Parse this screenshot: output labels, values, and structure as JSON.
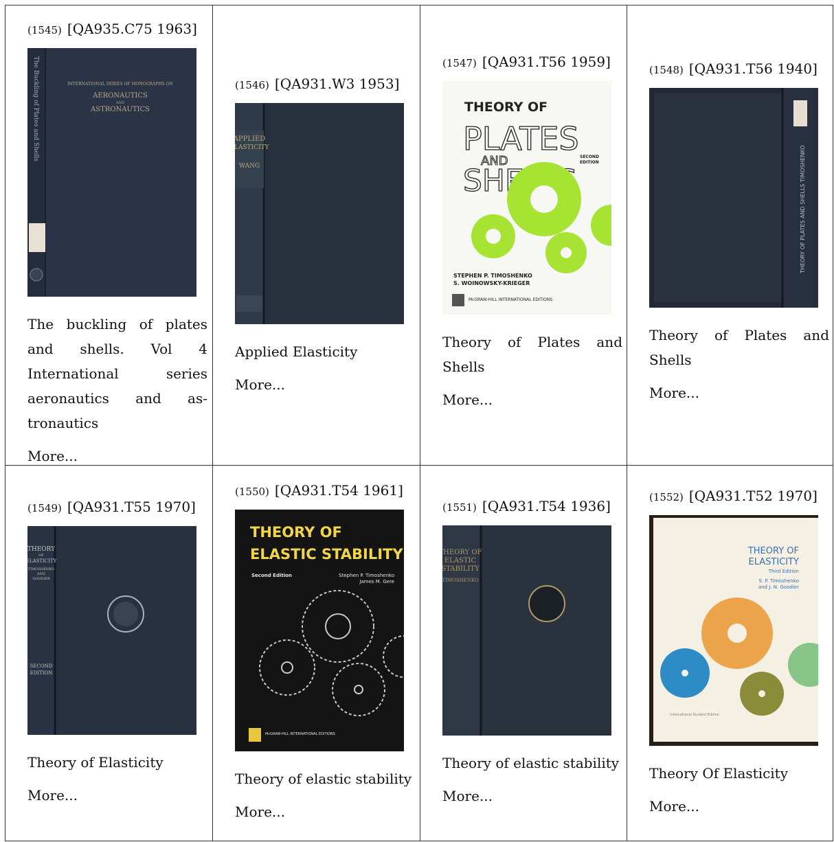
{
  "books": [
    {
      "num": "(1545)",
      "call": "[QA935.C75 1963]",
      "title": "The buckling of plates and shells. Vol 4 International series aeronautics and as-tronautics",
      "more": "More...",
      "cover": {
        "series": "INTERNATIONAL SERIES OF MONOGRAPHS ON",
        "line1": "AERONAUTICS",
        "and": "AND",
        "line2": "ASTRONAUTICS",
        "spine": "The Buckling of Plates and Shells"
      }
    },
    {
      "num": "(1546)",
      "call": "[QA931.W3 1953]",
      "title": "Applied Elasticity",
      "more": "More...",
      "cover": {
        "spine1": "APPLIED",
        "spine2": "ELASTICITY",
        "spine3": "WANG"
      }
    },
    {
      "num": "(1547)",
      "call": "[QA931.T56 1959]",
      "title": "Theory of Plates and Shells",
      "more": "More...",
      "cover": {
        "theory": "THEORY OF",
        "plates": "PLATES",
        "and": "AND",
        "shells": "SHELLS",
        "edition1": "SECOND",
        "edition2": "EDITION",
        "author1": "STEPHEN P. TIMOSHENKO",
        "author2": "S. WOINOWSKY-KRIEGER",
        "publisher": "McGRAW-HILL INTERNATIONAL EDITIONS"
      }
    },
    {
      "num": "(1548)",
      "call": "[QA931.T56 1940]",
      "title": "Theory of Plates and Shells",
      "more": "More...",
      "cover": {
        "spine": "THEORY OF PLATES AND SHELLS   TIMOSHENKO"
      }
    },
    {
      "num": "(1549)",
      "call": "[QA931.T55 1970]",
      "title": "Theory of Elasticity",
      "more": "More...",
      "cover": {
        "spine1": "THEORY",
        "spine2": "OF",
        "spine3": "ELASTICITY",
        "spine4": "TIMOSHENKO",
        "spine5": "AND",
        "spine6": "GOODIER",
        "edition1": "SECOND",
        "edition2": "EDITION"
      }
    },
    {
      "num": "(1550)",
      "call": "[QA931.T54 1961]",
      "title": "Theory of elastic stability",
      "more": "More...",
      "cover": {
        "line1": "THEORY OF",
        "line2": "ELASTIC STABILITY",
        "edition": "Second Edition",
        "author1": "Stephen P. Timoshenko",
        "author2": "James M. Gere",
        "publisher": "McGRAW-HILL INTERNATIONAL EDITIONS"
      }
    },
    {
      "num": "(1551)",
      "call": "[QA931.T54 1936]",
      "title": "Theory of elastic stability",
      "more": "More...",
      "cover": {
        "spine1": "THEORY OF",
        "spine2": "ELASTIC",
        "spine3": "STABILITY",
        "spine4": "TIMOSHENKO"
      }
    },
    {
      "num": "(1552)",
      "call": "[QA931.T52 1970]",
      "title": "Theory Of Elasticity",
      "more": "More...",
      "cover": {
        "line1": "THEORY OF",
        "line2": "ELASTICITY",
        "edition": "Third Edition",
        "author1": "S. P. Timoshenko",
        "author2": "and J. N. Goodier",
        "footer": "International Student Edition"
      }
    }
  ]
}
